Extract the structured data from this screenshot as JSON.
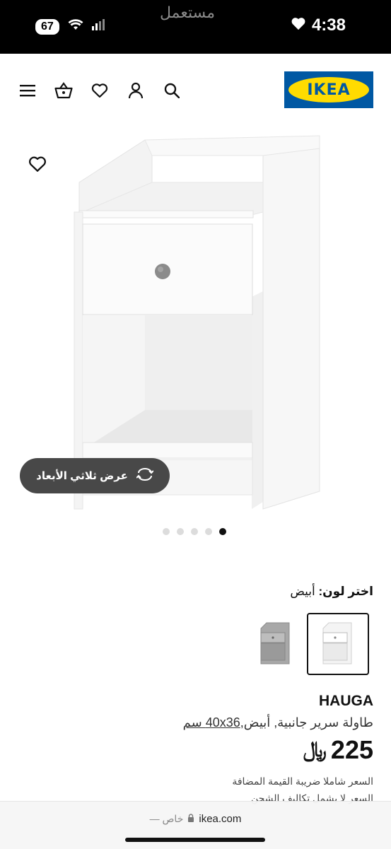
{
  "status_bar": {
    "battery": "67",
    "watermark": "مستعمل",
    "time": "4:38"
  },
  "header": {
    "icons": [
      "menu-icon",
      "basket-icon",
      "heart-icon",
      "user-icon",
      "search-icon"
    ],
    "logo_text": "IKEA",
    "colors": {
      "logo_blue": "#0058a3",
      "logo_yellow": "#ffdb00"
    }
  },
  "gallery": {
    "view_3d_label": "عرض ثلاثي الأبعاد",
    "dots_count": 5,
    "active_dot_index": 4
  },
  "color_picker": {
    "label_prefix": "اختر لون:",
    "selected_value": "أبيض",
    "options": [
      "white",
      "grey"
    ]
  },
  "product": {
    "name": "HAUGA",
    "description_main": "طاولة سرير جانبية, أبيض,",
    "description_dims": "40x36 سم",
    "price": "225",
    "currency_symbol": "﷼"
  },
  "notes": {
    "vat": "السعر شاملا ضريبة القيمة المضافة",
    "shipping": "السعر لا يشمل تكاليف الشحن"
  },
  "browser": {
    "url": "ikea.com",
    "private_label": "خاص —"
  }
}
